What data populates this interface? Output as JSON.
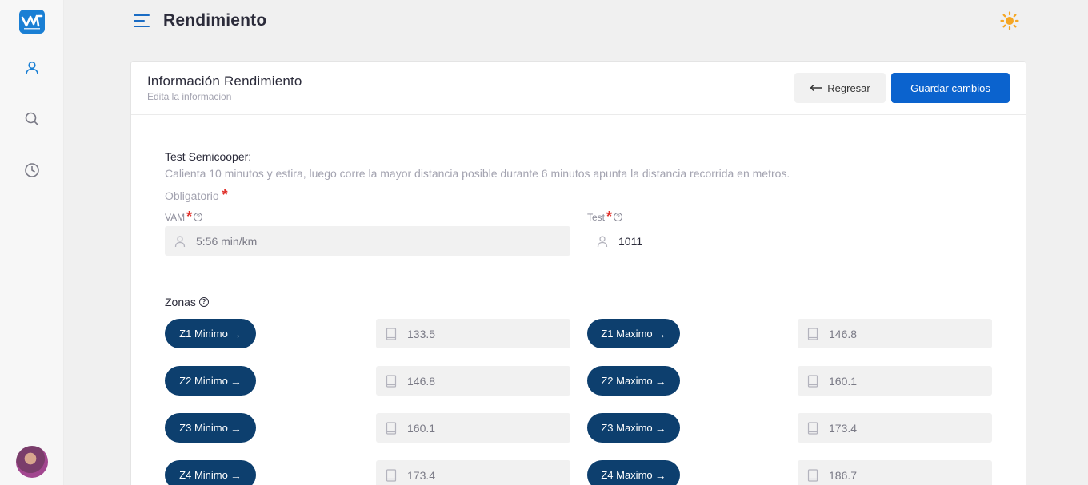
{
  "app": {
    "page_title": "Rendimiento"
  },
  "card": {
    "title": "Información Rendimiento",
    "subtitle": "Edita la informacion",
    "back_label": "Regresar",
    "save_label": "Guardar cambios"
  },
  "test": {
    "title": "Test Semicooper:",
    "description": "Calienta 10 minutos y estira, luego corre la mayor distancia posible durante 6 minutos apunta la distancia recorrida en metros.",
    "required_note": "Obligatorio",
    "vam_label": "VAM",
    "vam_value": "5:56 min/km",
    "test_label": "Test",
    "test_value": "1011"
  },
  "zones": {
    "label": "Zonas",
    "rows": [
      {
        "min_label": "Z1 Minimo",
        "min_value": "133.5",
        "max_label": "Z1 Maximo",
        "max_value": "146.8"
      },
      {
        "min_label": "Z2 Minimo",
        "min_value": "146.8",
        "max_label": "Z2 Maximo",
        "max_value": "160.1"
      },
      {
        "min_label": "Z3 Minimo",
        "min_value": "160.1",
        "max_label": "Z3 Maximo",
        "max_value": "173.4"
      },
      {
        "min_label": "Z4 Minimo",
        "min_value": "173.4",
        "max_label": "Z4 Maximo",
        "max_value": "186.7"
      }
    ]
  },
  "colors": {
    "primary": "#0b63ce",
    "zone_button": "#0d3f6e",
    "required": "#e0302a",
    "theme_icon": "#f5a623"
  },
  "icons": {
    "nav": [
      "user-icon",
      "search-icon",
      "history-icon"
    ],
    "theme": "sun-icon"
  }
}
